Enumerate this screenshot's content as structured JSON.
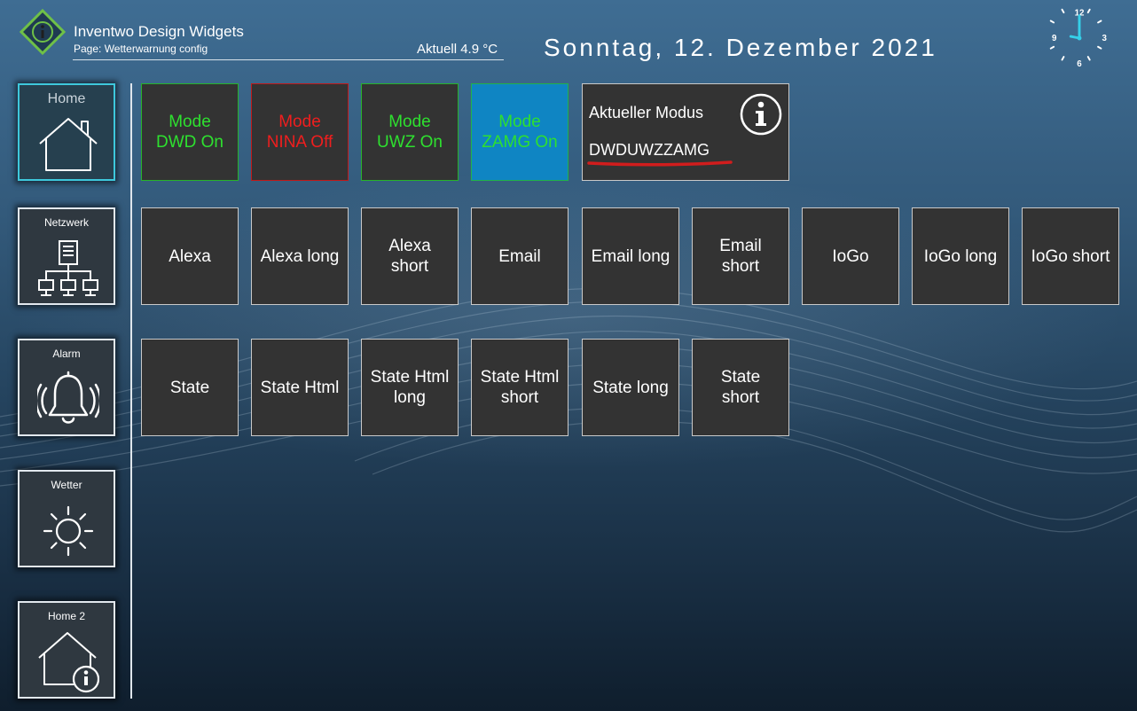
{
  "header": {
    "app_title": "Inventwo Design Widgets",
    "page_label": "Page: Wetterwarnung config",
    "temperature": "Aktuell 4.9 °C",
    "date": "Sonntag, 12. Dezember 2021"
  },
  "clock": {
    "numbers": [
      "12",
      "3",
      "6",
      "9"
    ]
  },
  "sidebar": {
    "items": [
      {
        "label": "Home",
        "icon": "house-icon",
        "active": true
      },
      {
        "label": "Netzwerk",
        "icon": "network-icon"
      },
      {
        "label": "Alarm",
        "icon": "bell-icon"
      },
      {
        "label": "Wetter",
        "icon": "sun-icon"
      },
      {
        "label": "Home 2",
        "icon": "house-info-icon"
      }
    ]
  },
  "modes": [
    {
      "line1": "Mode",
      "line2": "DWD On",
      "state": "on",
      "color": "#2ee02f"
    },
    {
      "line1": "Mode",
      "line2": "NINA Off",
      "state": "off",
      "color": "#ef1e1e"
    },
    {
      "line1": "Mode",
      "line2": "UWZ On",
      "state": "on",
      "color": "#2ee02f"
    },
    {
      "line1": "Mode",
      "line2": "ZAMG On",
      "state": "on",
      "color": "#2ee02f"
    }
  ],
  "current_mode": {
    "title": "Aktueller Modus",
    "value": "DWDUWZZAMG",
    "icon": "info-icon",
    "underline_color": "#d11d1d"
  },
  "buttons_row2": [
    {
      "line1": "Alexa",
      "line2": ""
    },
    {
      "line1": "Alexa long",
      "line2": ""
    },
    {
      "line1": "Alexa",
      "line2": "short"
    },
    {
      "line1": "Email",
      "line2": ""
    },
    {
      "line1": "Email long",
      "line2": ""
    },
    {
      "line1": "Email",
      "line2": "short"
    },
    {
      "line1": "IoGo",
      "line2": ""
    },
    {
      "line1": "IoGo long",
      "line2": ""
    },
    {
      "line1": "IoGo short",
      "line2": ""
    }
  ],
  "buttons_row3": [
    {
      "line1": "State",
      "line2": ""
    },
    {
      "line1": "State Html",
      "line2": ""
    },
    {
      "line1": "State Html",
      "line2": "long"
    },
    {
      "line1": "State Html",
      "line2": "short"
    },
    {
      "line1": "State long",
      "line2": ""
    },
    {
      "line1": "State",
      "line2": "short"
    }
  ],
  "colors": {
    "tile_background": "#333333",
    "mode_on_border": "#27b32a",
    "mode_off_border": "#c21818",
    "zamg_background": "#0f85c3",
    "active_nav_border": "#3ec8dc",
    "clock_hands": "#35d0e8",
    "logo_green": "#6fc047"
  }
}
